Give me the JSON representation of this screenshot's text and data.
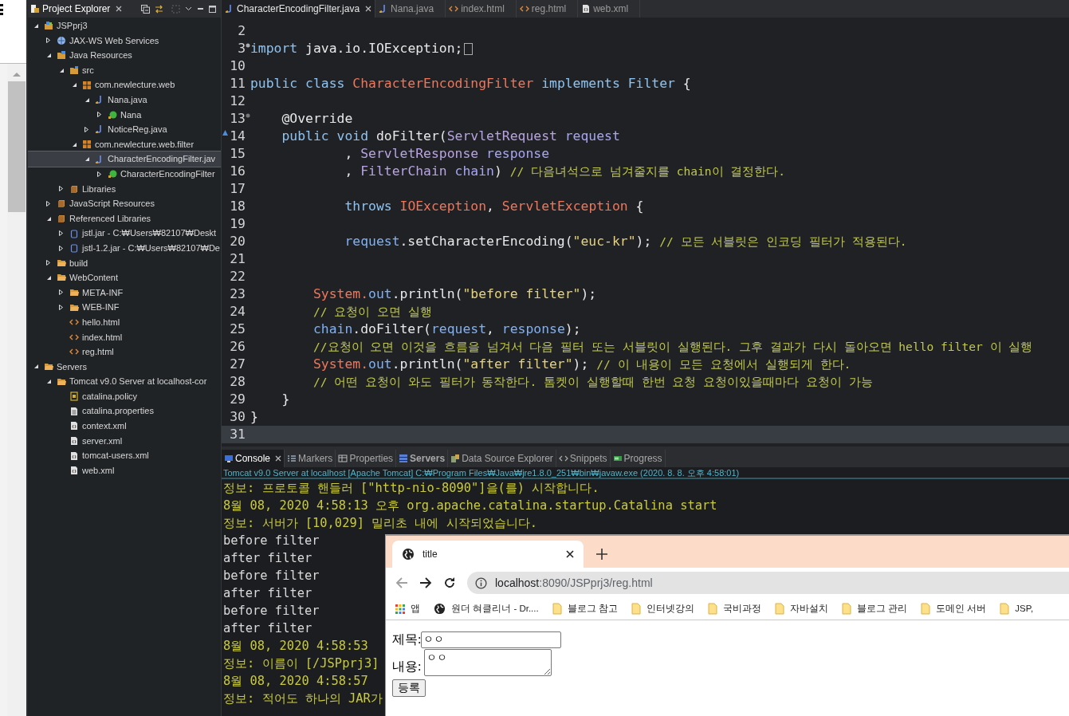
{
  "explorer": {
    "title": "Project Explorer",
    "tree": [
      {
        "label": "JSPprj3",
        "kind": "project",
        "expanded": true,
        "selected": false,
        "children": [
          {
            "label": "JAX-WS Web Services",
            "kind": "services",
            "expanded": false,
            "selected": false
          },
          {
            "label": "Java Resources",
            "kind": "resources",
            "expanded": true,
            "selected": false,
            "children": [
              {
                "label": "src",
                "kind": "srcfolder",
                "expanded": true,
                "selected": false,
                "children": [
                  {
                    "label": "com.newlecture.web",
                    "kind": "package",
                    "expanded": true,
                    "selected": false,
                    "children": [
                      {
                        "label": "Nana.java",
                        "kind": "java",
                        "expanded": true,
                        "selected": false,
                        "children": [
                          {
                            "label": "Nana",
                            "kind": "class",
                            "expanded": false,
                            "selected": false
                          }
                        ]
                      },
                      {
                        "label": "NoticeReg.java",
                        "kind": "java",
                        "expanded": false,
                        "selected": false
                      }
                    ]
                  },
                  {
                    "label": "com.newlecture.web.filter",
                    "kind": "package",
                    "expanded": true,
                    "selected": false,
                    "children": [
                      {
                        "label": "CharacterEncodingFilter.jav",
                        "kind": "java",
                        "expanded": true,
                        "selected": true,
                        "children": [
                          {
                            "label": "CharacterEncodingFilter",
                            "kind": "class",
                            "expanded": false,
                            "selected": false
                          }
                        ]
                      }
                    ]
                  }
                ]
              },
              {
                "label": "Libraries",
                "kind": "library",
                "expanded": false,
                "selected": false
              }
            ]
          },
          {
            "label": "JavaScript Resources",
            "kind": "library",
            "expanded": false,
            "selected": false
          },
          {
            "label": "Referenced Libraries",
            "kind": "library",
            "expanded": true,
            "selected": false,
            "children": [
              {
                "label": "jstl.jar - C:₩Users₩82107₩Deskt",
                "kind": "jar",
                "expanded": false,
                "selected": false
              },
              {
                "label": "jstl-1.2.jar - C:₩Users₩82107₩De",
                "kind": "jar",
                "expanded": false,
                "selected": false
              }
            ]
          },
          {
            "label": "build",
            "kind": "folder",
            "expanded": false,
            "selected": false
          },
          {
            "label": "WebContent",
            "kind": "folder",
            "expanded": true,
            "selected": false,
            "children": [
              {
                "label": "META-INF",
                "kind": "folder",
                "expanded": false,
                "selected": false
              },
              {
                "label": "WEB-INF",
                "kind": "folder",
                "expanded": false,
                "selected": false
              },
              {
                "label": "hello.html",
                "kind": "html",
                "selected": false
              },
              {
                "label": "index.html",
                "kind": "html",
                "selected": false
              },
              {
                "label": "reg.html",
                "kind": "html",
                "selected": false
              }
            ]
          }
        ]
      },
      {
        "label": "Servers",
        "kind": "folder",
        "expanded": true,
        "selected": false,
        "children": [
          {
            "label": "Tomcat v9.0 Server at localhost-cor",
            "kind": "folder",
            "expanded": true,
            "selected": false,
            "children": [
              {
                "label": "catalina.policy",
                "kind": "policy",
                "selected": false
              },
              {
                "label": "catalina.properties",
                "kind": "file",
                "selected": false
              },
              {
                "label": "context.xml",
                "kind": "xml",
                "selected": false
              },
              {
                "label": "server.xml",
                "kind": "xml",
                "selected": false
              },
              {
                "label": "tomcat-users.xml",
                "kind": "xml",
                "selected": false
              },
              {
                "label": "web.xml",
                "kind": "xml",
                "selected": false
              }
            ]
          }
        ]
      }
    ]
  },
  "editor": {
    "tabs": [
      {
        "label": "CharacterEncodingFilter.java",
        "kind": "java",
        "selected": true
      },
      {
        "label": "Nana.java",
        "kind": "java",
        "selected": false
      },
      {
        "label": "index.html",
        "kind": "html",
        "selected": false
      },
      {
        "label": "reg.html",
        "kind": "html",
        "selected": false
      },
      {
        "label": "web.xml",
        "kind": "xml",
        "selected": false
      }
    ],
    "lines": [
      {
        "num": "2",
        "current": false
      },
      {
        "num": "3",
        "folded": true,
        "current": false,
        "tokens": [
          {
            "kind": "kw",
            "text": "import"
          },
          {
            "kind": "plain",
            "text": " java.io.IOException;"
          }
        ]
      },
      {
        "num": "10",
        "current": false
      },
      {
        "num": "11",
        "current": false,
        "tokens": [
          {
            "kind": "kw",
            "text": "public class "
          },
          {
            "kind": "cls",
            "text": "CharacterEncodingFilter"
          },
          {
            "kind": "kw",
            "text": " implements Filter"
          },
          {
            "kind": "plain",
            "text": " {"
          }
        ]
      },
      {
        "num": "12",
        "current": false
      },
      {
        "num": "13",
        "foldable": true,
        "current": false,
        "tokens": [
          {
            "kind": "ann",
            "text": "    @Override"
          }
        ]
      },
      {
        "num": "14",
        "override": true,
        "current": false,
        "tokens": [
          {
            "kind": "kw",
            "text": "    public void "
          },
          {
            "kind": "plain",
            "text": "doFilter("
          },
          {
            "kind": "type",
            "text": "ServletRequest"
          },
          {
            "kind": "param",
            "text": " request"
          }
        ]
      },
      {
        "num": "15",
        "current": false,
        "tokens": [
          {
            "kind": "plain",
            "text": "            , "
          },
          {
            "kind": "type",
            "text": "ServletResponse"
          },
          {
            "kind": "param",
            "text": " response"
          }
        ]
      },
      {
        "num": "16",
        "current": false,
        "tokens": [
          {
            "kind": "plain",
            "text": "            , "
          },
          {
            "kind": "type",
            "text": "FilterChain"
          },
          {
            "kind": "param",
            "text": " chain"
          },
          {
            "kind": "plain",
            "text": ") "
          },
          {
            "kind": "cmt",
            "text": "// 다음녀석으로 넘겨줄지를 chain이 결정한다."
          }
        ]
      },
      {
        "num": "17",
        "current": false
      },
      {
        "num": "18",
        "current": false,
        "tokens": [
          {
            "kind": "kw",
            "text": "            throws"
          },
          {
            "kind": "cls",
            "text": " IOException"
          },
          {
            "kind": "plain",
            "text": ", "
          },
          {
            "kind": "cls",
            "text": "ServletException"
          },
          {
            "kind": "plain",
            "text": " {"
          }
        ]
      },
      {
        "num": "19",
        "current": false
      },
      {
        "num": "20",
        "current": false,
        "tokens": [
          {
            "kind": "var",
            "text": "            request"
          },
          {
            "kind": "plain",
            "text": ".setCharacterEncoding("
          },
          {
            "kind": "str",
            "text": "\"euc-kr\""
          },
          {
            "kind": "plain",
            "text": "); "
          },
          {
            "kind": "cmt",
            "text": "// 모든 서블릿은 인코딩 필터가 적용된다."
          }
        ]
      },
      {
        "num": "21",
        "current": false
      },
      {
        "num": "22",
        "current": false
      },
      {
        "num": "23",
        "current": false,
        "tokens": [
          {
            "kind": "cls",
            "text": "        System."
          },
          {
            "kind": "var",
            "text": "out"
          },
          {
            "kind": "plain",
            "text": ".println("
          },
          {
            "kind": "str",
            "text": "\"before filter\""
          },
          {
            "kind": "plain",
            "text": ");"
          }
        ]
      },
      {
        "num": "24",
        "current": false,
        "tokens": [
          {
            "kind": "cmt",
            "text": "        // 요청이 오면 실행"
          }
        ]
      },
      {
        "num": "25",
        "current": false,
        "tokens": [
          {
            "kind": "var",
            "text": "        chain"
          },
          {
            "kind": "plain",
            "text": ".doFilter("
          },
          {
            "kind": "var",
            "text": "request"
          },
          {
            "kind": "plain",
            "text": ", "
          },
          {
            "kind": "var",
            "text": "response"
          },
          {
            "kind": "plain",
            "text": ");"
          }
        ]
      },
      {
        "num": "26",
        "current": false,
        "tokens": [
          {
            "kind": "cmt",
            "text": "        //요청이 오면 이것을 흐름을 넘겨서 다음 필터 또는 서블릿이 실행된다. 그후 결과가 다시 돌아오면 hello filter 이 실행"
          }
        ]
      },
      {
        "num": "27",
        "current": false,
        "tokens": [
          {
            "kind": "cls",
            "text": "        System."
          },
          {
            "kind": "var",
            "text": "out"
          },
          {
            "kind": "plain",
            "text": ".println("
          },
          {
            "kind": "str",
            "text": "\"after filter\""
          },
          {
            "kind": "plain",
            "text": "); "
          },
          {
            "kind": "cmt",
            "text": "// 이 내용이 모든 요청에서 실행되게 한다."
          }
        ]
      },
      {
        "num": "28",
        "current": false,
        "tokens": [
          {
            "kind": "cmt",
            "text": "        // 어떤 요청이 와도 필터가 동작한다. 톰켓이 실행할때 한번 요청 요청이있을때마다 요청이 가능"
          }
        ]
      },
      {
        "num": "29",
        "current": false,
        "tokens": [
          {
            "kind": "plain",
            "text": "    }"
          }
        ]
      },
      {
        "num": "30",
        "current": false,
        "tokens": [
          {
            "kind": "plain",
            "text": "}"
          }
        ]
      },
      {
        "num": "31",
        "current": true
      }
    ]
  },
  "console": {
    "tabs": [
      {
        "label": "Console",
        "kind": "console",
        "selected": true,
        "bold": false
      },
      {
        "label": "Markers",
        "kind": "markers",
        "selected": false,
        "bold": false
      },
      {
        "label": "Properties",
        "kind": "properties",
        "selected": false,
        "bold": false
      },
      {
        "label": "Servers",
        "kind": "servers",
        "selected": false,
        "bold": true
      },
      {
        "label": "Data Source Explorer",
        "kind": "datasource",
        "selected": false,
        "bold": false
      },
      {
        "label": "Snippets",
        "kind": "snippets",
        "selected": false,
        "bold": false
      },
      {
        "label": "Progress",
        "kind": "progress",
        "selected": false,
        "bold": false
      }
    ],
    "process": "Tomcat v9.0 Server at localhost [Apache Tomcat] C:₩Program Files₩Java₩jre1.8.0_251₩bin₩javaw.exe (2020. 8. 8. 오후 4:58:01)",
    "lines": [
      {
        "kind": "err",
        "text": "정보: 프로토콜 핸들러 [\"http-nio-8090\"]을(를) 시작합니다."
      },
      {
        "kind": "err",
        "text": "8월 08, 2020 4:58:13 오후 org.apache.catalina.startup.Catalina start"
      },
      {
        "kind": "err",
        "text": "정보: 서버가 [10,029] 밀리초 내에 시작되었습니다."
      },
      {
        "kind": "out",
        "text": "before filter"
      },
      {
        "kind": "out",
        "text": "after filter"
      },
      {
        "kind": "out",
        "text": "before filter"
      },
      {
        "kind": "out",
        "text": "after filter"
      },
      {
        "kind": "out",
        "text": "before filter"
      },
      {
        "kind": "out",
        "text": "after filter"
      },
      {
        "kind": "err",
        "text": "8월 08, 2020 4:58:53"
      },
      {
        "kind": "err",
        "text": "정보: 이름이 [/JSPprj3]"
      },
      {
        "kind": "err",
        "text": "8월 08, 2020 4:58:57"
      },
      {
        "kind": "err",
        "text": "정보: 적어도 하나의 JAR가"
      }
    ]
  },
  "browser": {
    "tab": {
      "title": "title"
    },
    "back": {
      "disabled": true
    },
    "address": {
      "host": "localhost",
      "path": ":8090/JSPprj3/reg.html"
    },
    "bookmarks": [
      {
        "kind": "apps",
        "label": "앱"
      },
      {
        "kind": "site",
        "label": "원더 혀클리너 - Dr...."
      },
      {
        "kind": "folder",
        "label": "블로그 참고"
      },
      {
        "kind": "folder",
        "label": "인터넷강의"
      },
      {
        "kind": "folder",
        "label": "국비과정"
      },
      {
        "kind": "folder",
        "label": "자바설치"
      },
      {
        "kind": "folder",
        "label": "블로그 관리"
      },
      {
        "kind": "folder",
        "label": "도메인 서버"
      },
      {
        "kind": "folder",
        "label": "JSP,"
      }
    ],
    "form": {
      "title_label": "제목:",
      "title_value": "ㅇㅇ",
      "content_label": "내용:",
      "content_value": "ㅇㅇ",
      "submit": "등록"
    }
  }
}
